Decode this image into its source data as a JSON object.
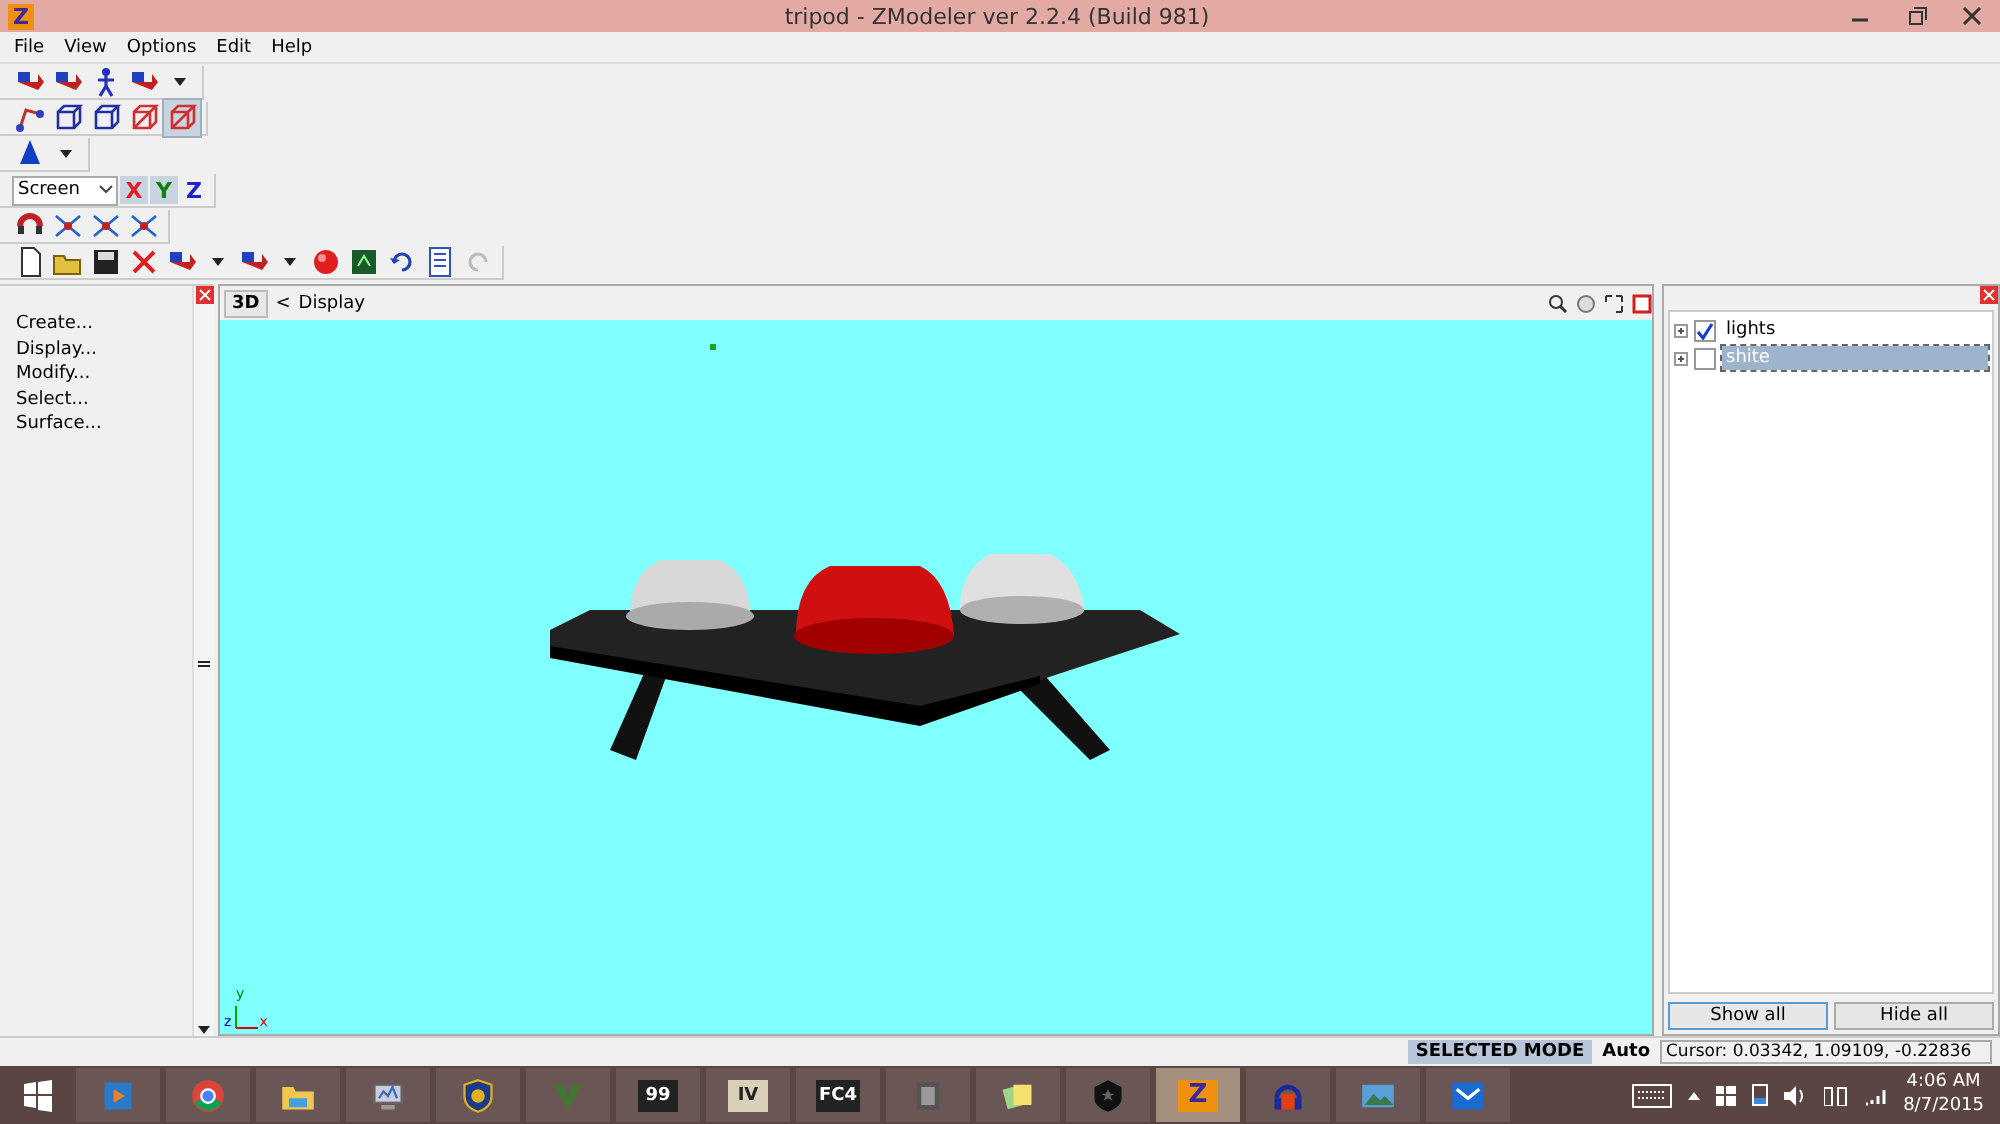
{
  "window": {
    "title": "tripod - ZModeler ver 2.2.4 (Build 981)",
    "app_icon_label": "Z"
  },
  "menu": [
    "File",
    "View",
    "Options",
    "Edit",
    "Help"
  ],
  "toolbar": {
    "space": "Screen",
    "axes": [
      {
        "label": "X",
        "selected": true,
        "color": "#e02020"
      },
      {
        "label": "Y",
        "selected": true,
        "color": "#108010"
      },
      {
        "label": "Z",
        "selected": false,
        "color": "#2020d0"
      }
    ],
    "modes": [
      {
        "selected": false
      },
      {
        "selected": false
      },
      {
        "selected": false
      },
      {
        "selected": false
      },
      {
        "selected": true
      }
    ]
  },
  "left_panel": {
    "items": [
      "Create...",
      "Display...",
      "Modify...",
      "Select...",
      "Surface..."
    ]
  },
  "viewport": {
    "view_button": "3D",
    "back": "<",
    "title": "Display",
    "axis_labels": [
      "y",
      "z",
      "x"
    ]
  },
  "tree": [
    {
      "label": "lights",
      "checked": true,
      "selected": false
    },
    {
      "label": "shite",
      "checked": false,
      "selected": true
    }
  ],
  "tree_buttons": [
    {
      "label": "Show all",
      "selected": true
    },
    {
      "label": "Hide all",
      "selected": false
    }
  ],
  "status_bar": {
    "mode": "SELECTED MODE",
    "auto": "Auto",
    "cursor": "Cursor: 0.03342, 1.09109, -0.22836"
  },
  "taskbar": {
    "apps": [
      {
        "selected": false
      },
      {
        "selected": false
      },
      {
        "selected": false
      },
      {
        "selected": false
      },
      {
        "selected": false
      },
      {
        "selected": false
      },
      {
        "label": "99",
        "selected": false
      },
      {
        "label": "IV",
        "selected": false
      },
      {
        "label": "FC4",
        "selected": false
      },
      {
        "selected": false
      },
      {
        "selected": false
      },
      {
        "selected": false
      },
      {
        "label": "Z",
        "selected": true
      },
      {
        "selected": false
      },
      {
        "selected": false
      },
      {
        "selected": false
      }
    ],
    "time": "4:06 AM",
    "date": "8/7/2015"
  }
}
